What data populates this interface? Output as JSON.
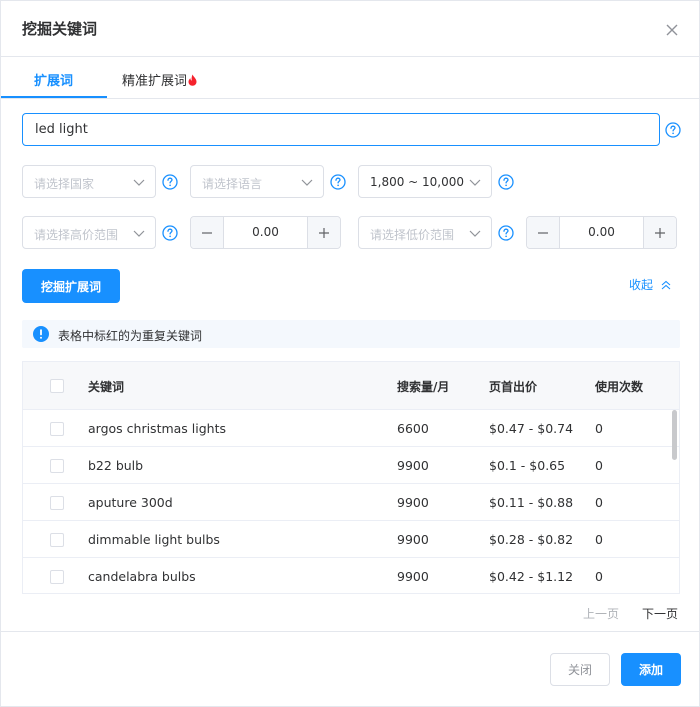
{
  "dialog": {
    "title": "挖掘关键词"
  },
  "tabs": [
    {
      "label": "扩展词",
      "active": true
    },
    {
      "label": "精准扩展词",
      "active": false,
      "badge_icon": "fire-icon"
    }
  ],
  "keyword_input": {
    "value": "led light"
  },
  "filters": {
    "country": {
      "placeholder": "请选择国家"
    },
    "language": {
      "placeholder": "请选择语言"
    },
    "volume_range": {
      "value": "1,800 ~ 10,000"
    },
    "high_bid_range": {
      "placeholder": "请选择高价范围"
    },
    "high_bid_value": "0.00",
    "low_bid_range": {
      "placeholder": "请选择低价范围"
    },
    "low_bid_value": "0.00"
  },
  "actions": {
    "mine_button": "挖掘扩展词",
    "collapse_link": "收起"
  },
  "notice": {
    "text": "表格中标红的为重复关键词"
  },
  "table": {
    "columns": [
      "关键词",
      "搜索量/月",
      "页首出价",
      "使用次数"
    ],
    "rows": [
      {
        "keyword": "argos christmas lights",
        "volume": "6600",
        "bid": "$0.47 - $0.74",
        "uses": "0"
      },
      {
        "keyword": "b22 bulb",
        "volume": "9900",
        "bid": "$0.1 - $0.65",
        "uses": "0"
      },
      {
        "keyword": "aputure 300d",
        "volume": "9900",
        "bid": "$0.11 - $0.88",
        "uses": "0"
      },
      {
        "keyword": "dimmable light bulbs",
        "volume": "9900",
        "bid": "$0.28 - $0.82",
        "uses": "0"
      },
      {
        "keyword": "candelabra bulbs",
        "volume": "9900",
        "bid": "$0.42 - $1.12",
        "uses": "0"
      }
    ]
  },
  "pagination": {
    "prev": "上一页",
    "next": "下一页"
  },
  "footer": {
    "close_button": "关闭",
    "add_button": "添加"
  },
  "colors": {
    "primary": "#1890ff",
    "border": "#dcdfe6",
    "fire": "#f5222d"
  }
}
